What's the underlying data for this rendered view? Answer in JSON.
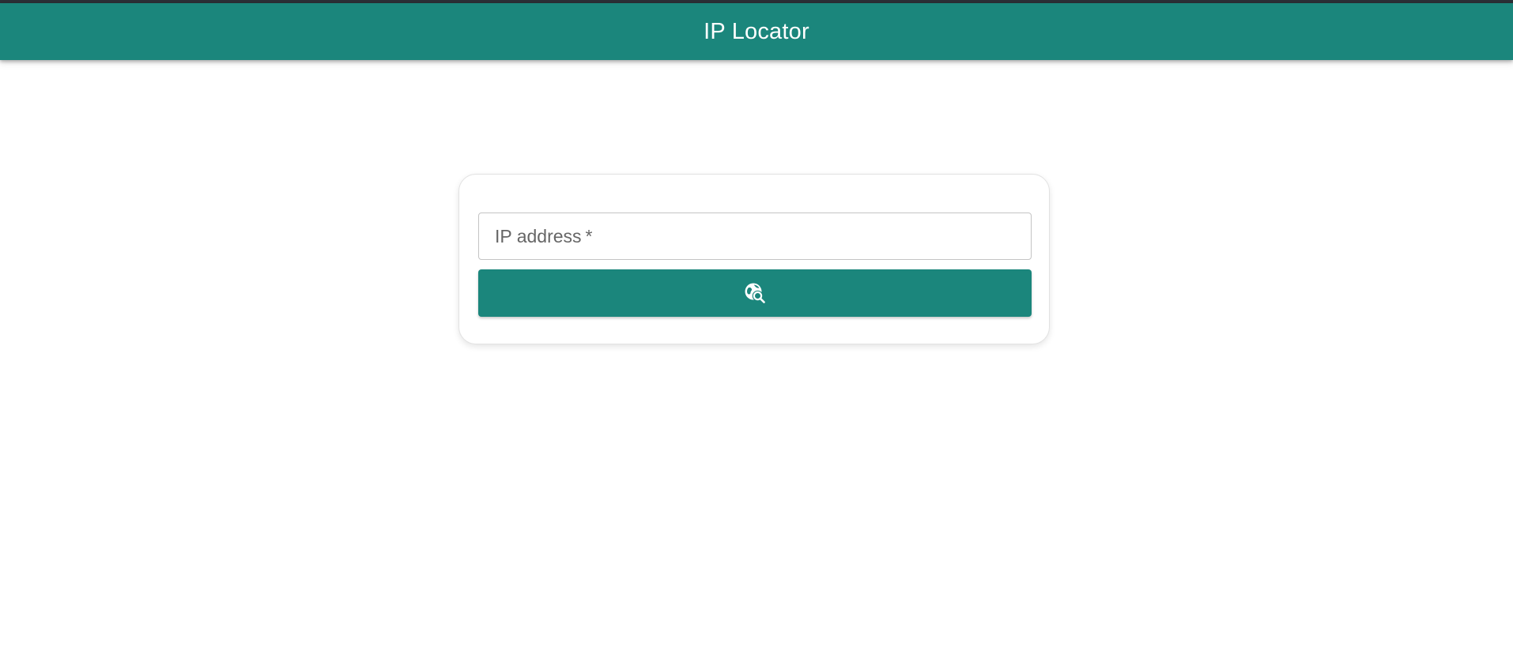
{
  "header": {
    "title": "IP Locator",
    "background": "#1b867c",
    "text_color": "#ffffff"
  },
  "form": {
    "ip_field": {
      "label": "IP address",
      "required_marker": "*",
      "value": ""
    },
    "locate_button": {
      "icon": "travel-explore-icon",
      "background": "#1b867c",
      "icon_color": "#ffffff"
    }
  }
}
